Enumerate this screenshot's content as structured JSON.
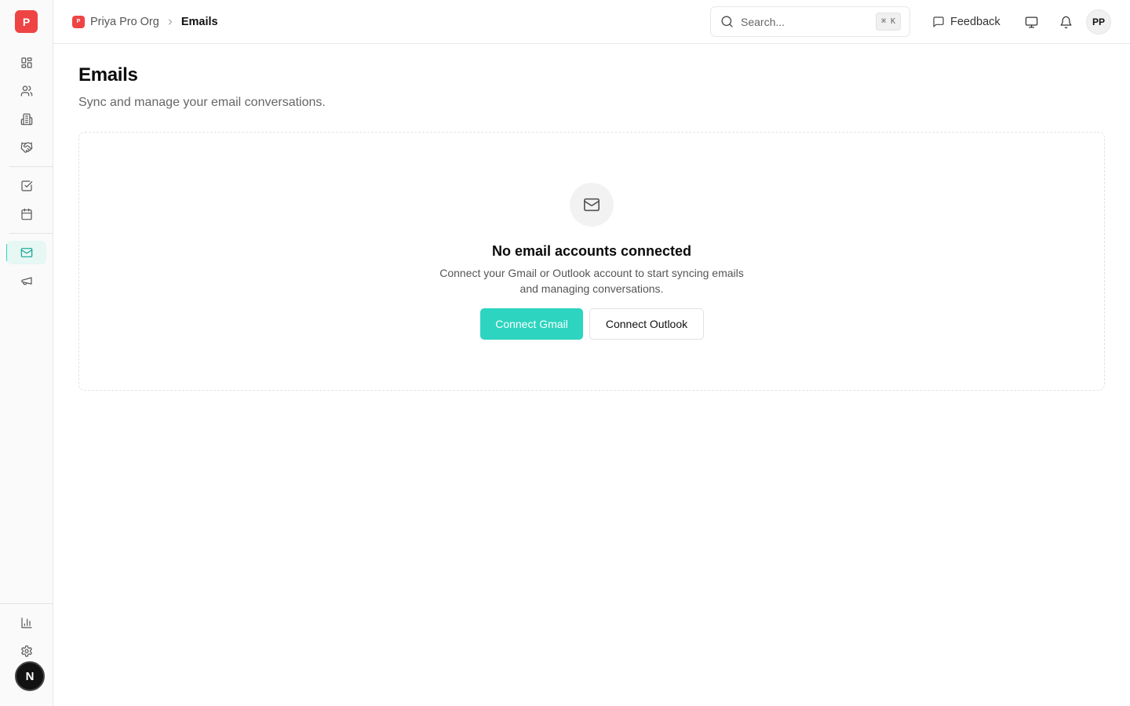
{
  "sidebar": {
    "logo_letter": "P",
    "nav_icons": [
      "dashboard-icon",
      "contacts-icon",
      "companies-icon",
      "deals-icon",
      "tasks-icon",
      "calendar-icon",
      "emails-icon",
      "campaigns-icon",
      "reports-icon",
      "settings-icon"
    ],
    "active_item": "emails",
    "bottom_badge": "N"
  },
  "header": {
    "org_initial": "P",
    "org_name": "Priya Pro Org",
    "current_page": "Emails",
    "search_placeholder": "Search...",
    "search_shortcut": "⌘ K",
    "feedback_label": "Feedback",
    "avatar_initials": "PP"
  },
  "main": {
    "title": "Emails",
    "subtitle": "Sync and manage your email conversations.",
    "empty_state": {
      "icon": "mail-icon",
      "title": "No email accounts connected",
      "description": "Connect your Gmail or Outlook account to start syncing emails and managing conversations.",
      "primary_button": "Connect Gmail",
      "secondary_button": "Connect Outlook"
    }
  },
  "colors": {
    "brand": "#ef4444",
    "accent": "#2dd4bf",
    "active_nav_bg": "#e6f7f4"
  }
}
